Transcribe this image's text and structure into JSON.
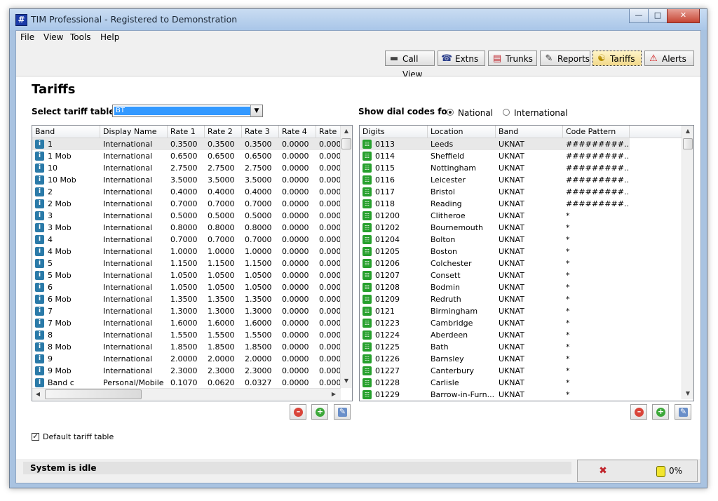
{
  "window": {
    "title": "TIM Professional - Registered to Demonstration"
  },
  "menu": [
    "File",
    "View",
    "Tools",
    "Help"
  ],
  "toolbar": [
    {
      "label": "Call View",
      "icon": "call-view-icon"
    },
    {
      "label": "Extns",
      "icon": "phone-icon"
    },
    {
      "label": "Trunks",
      "icon": "trunks-icon"
    },
    {
      "label": "Reports",
      "icon": "reports-icon"
    },
    {
      "label": "Tariffs",
      "icon": "tariffs-icon",
      "active": true
    },
    {
      "label": "Alerts",
      "icon": "warning-icon"
    }
  ],
  "page": {
    "title": "Tariffs",
    "select_label": "Select tariff table",
    "select_value": "BT",
    "dial_codes_label": "Show dial codes for",
    "radio_national": "National",
    "radio_international": "International",
    "radio_selected": "National",
    "default_checkbox_label": "Default tariff table",
    "default_checked": true
  },
  "left_table": {
    "columns": [
      "Band",
      "Display Name",
      "Rate 1",
      "Rate 2",
      "Rate 3",
      "Rate 4",
      "Rate"
    ],
    "rows": [
      [
        "1",
        "International",
        "0.3500",
        "0.3500",
        "0.3500",
        "0.0000",
        "0.000"
      ],
      [
        "1 Mob",
        "International",
        "0.6500",
        "0.6500",
        "0.6500",
        "0.0000",
        "0.000"
      ],
      [
        "10",
        "International",
        "2.7500",
        "2.7500",
        "2.7500",
        "0.0000",
        "0.000"
      ],
      [
        "10 Mob",
        "International",
        "3.5000",
        "3.5000",
        "3.5000",
        "0.0000",
        "0.000"
      ],
      [
        "2",
        "International",
        "0.4000",
        "0.4000",
        "0.4000",
        "0.0000",
        "0.000"
      ],
      [
        "2 Mob",
        "International",
        "0.7000",
        "0.7000",
        "0.7000",
        "0.0000",
        "0.000"
      ],
      [
        "3",
        "International",
        "0.5000",
        "0.5000",
        "0.5000",
        "0.0000",
        "0.000"
      ],
      [
        "3 Mob",
        "International",
        "0.8000",
        "0.8000",
        "0.8000",
        "0.0000",
        "0.000"
      ],
      [
        "4",
        "International",
        "0.7000",
        "0.7000",
        "0.7000",
        "0.0000",
        "0.000"
      ],
      [
        "4 Mob",
        "International",
        "1.0000",
        "1.0000",
        "1.0000",
        "0.0000",
        "0.000"
      ],
      [
        "5",
        "International",
        "1.1500",
        "1.1500",
        "1.1500",
        "0.0000",
        "0.000"
      ],
      [
        "5 Mob",
        "International",
        "1.0500",
        "1.0500",
        "1.0500",
        "0.0000",
        "0.000"
      ],
      [
        "6",
        "International",
        "1.0500",
        "1.0500",
        "1.0500",
        "0.0000",
        "0.000"
      ],
      [
        "6 Mob",
        "International",
        "1.3500",
        "1.3500",
        "1.3500",
        "0.0000",
        "0.000"
      ],
      [
        "7",
        "International",
        "1.3000",
        "1.3000",
        "1.3000",
        "0.0000",
        "0.000"
      ],
      [
        "7 Mob",
        "International",
        "1.6000",
        "1.6000",
        "1.6000",
        "0.0000",
        "0.000"
      ],
      [
        "8",
        "International",
        "1.5500",
        "1.5500",
        "1.5500",
        "0.0000",
        "0.000"
      ],
      [
        "8 Mob",
        "International",
        "1.8500",
        "1.8500",
        "1.8500",
        "0.0000",
        "0.000"
      ],
      [
        "9",
        "International",
        "2.0000",
        "2.0000",
        "2.0000",
        "0.0000",
        "0.000"
      ],
      [
        "9 Mob",
        "International",
        "2.3000",
        "2.3000",
        "2.3000",
        "0.0000",
        "0.000"
      ],
      [
        "Band c",
        "Personal/Mobile",
        "0.1070",
        "0.0620",
        "0.0327",
        "0.0000",
        "0.000"
      ]
    ]
  },
  "right_table": {
    "columns": [
      "Digits",
      "Location",
      "Band",
      "Code Pattern"
    ],
    "rows": [
      [
        "0113",
        "Leeds",
        "UKNAT",
        "#########..."
      ],
      [
        "0114",
        "Sheffield",
        "UKNAT",
        "#########..."
      ],
      [
        "0115",
        "Nottingham",
        "UKNAT",
        "#########..."
      ],
      [
        "0116",
        "Leicester",
        "UKNAT",
        "#########..."
      ],
      [
        "0117",
        "Bristol",
        "UKNAT",
        "#########..."
      ],
      [
        "0118",
        "Reading",
        "UKNAT",
        "#########..."
      ],
      [
        "01200",
        "Clitheroe",
        "UKNAT",
        "*"
      ],
      [
        "01202",
        "Bournemouth",
        "UKNAT",
        "*"
      ],
      [
        "01204",
        "Bolton",
        "UKNAT",
        "*"
      ],
      [
        "01205",
        "Boston",
        "UKNAT",
        "*"
      ],
      [
        "01206",
        "Colchester",
        "UKNAT",
        "*"
      ],
      [
        "01207",
        "Consett",
        "UKNAT",
        "*"
      ],
      [
        "01208",
        "Bodmin",
        "UKNAT",
        "*"
      ],
      [
        "01209",
        "Redruth",
        "UKNAT",
        "*"
      ],
      [
        "0121",
        "Birmingham",
        "UKNAT",
        "*"
      ],
      [
        "01223",
        "Cambridge",
        "UKNAT",
        "*"
      ],
      [
        "01224",
        "Aberdeen",
        "UKNAT",
        "*"
      ],
      [
        "01225",
        "Bath",
        "UKNAT",
        "*"
      ],
      [
        "01226",
        "Barnsley",
        "UKNAT",
        "*"
      ],
      [
        "01227",
        "Canterbury",
        "UKNAT",
        "*"
      ],
      [
        "01228",
        "Carlisle",
        "UKNAT",
        "*"
      ],
      [
        "01229",
        "Barrow-in-Furn...",
        "UKNAT",
        "*"
      ]
    ]
  },
  "status": {
    "text": "System is idle",
    "progress": "0%"
  },
  "colors": {
    "selection": "#3399ff",
    "status_bg": "#e2e2e2"
  }
}
